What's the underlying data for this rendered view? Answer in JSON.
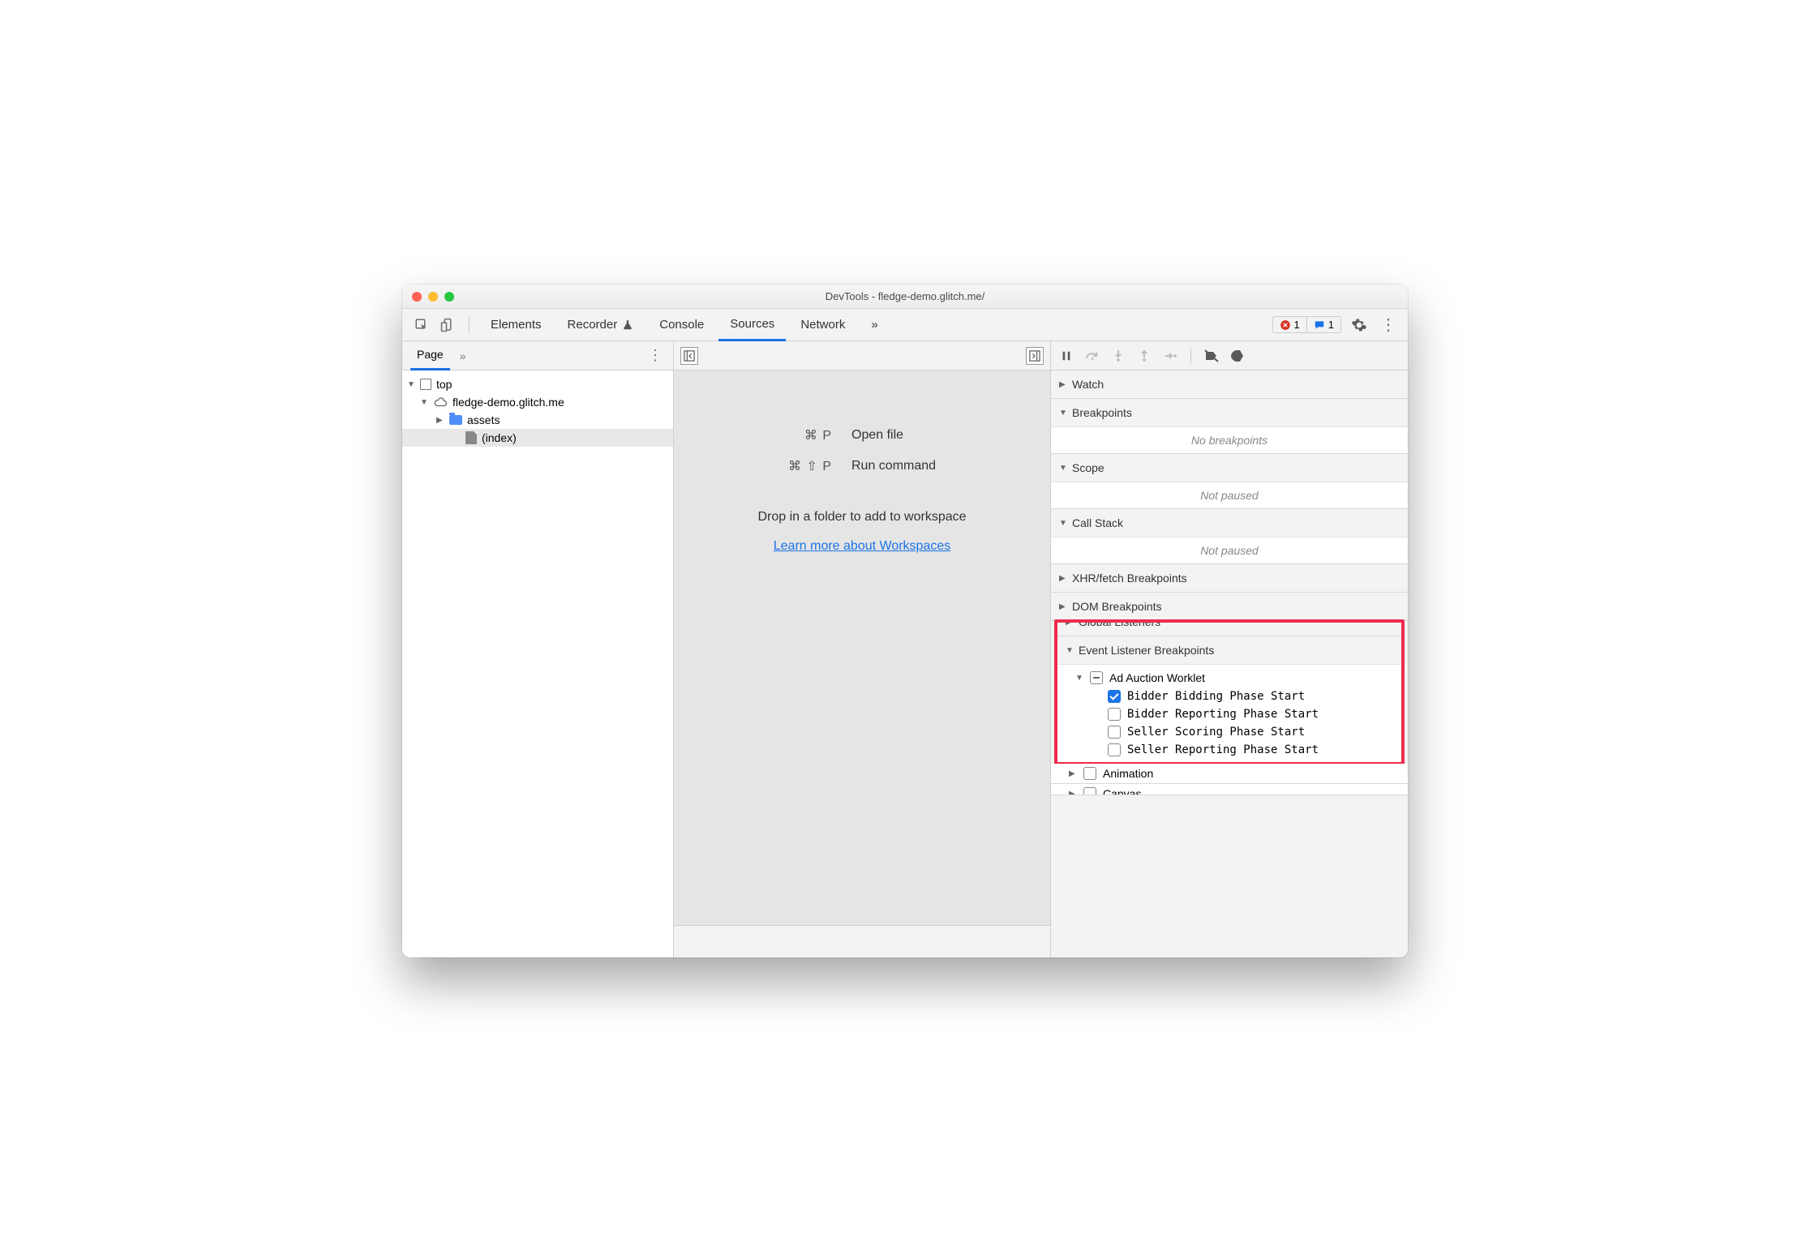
{
  "window": {
    "title": "DevTools - fledge-demo.glitch.me/"
  },
  "toolbar": {
    "tabs": {
      "elements": "Elements",
      "recorder": "Recorder",
      "console": "Console",
      "sources": "Sources",
      "network": "Network"
    },
    "more_glyph": "»",
    "errors_count": "1",
    "messages_count": "1"
  },
  "left": {
    "page_tab": "Page",
    "more_glyph": "»",
    "tree": {
      "top": "top",
      "domain": "fledge-demo.glitch.me",
      "assets": "assets",
      "index": "(index)"
    }
  },
  "mid": {
    "open_file_keys": "⌘ P",
    "open_file_label": "Open file",
    "run_cmd_keys": "⌘ ⇧ P",
    "run_cmd_label": "Run command",
    "drop_hint": "Drop in a folder to add to workspace",
    "learn_more": "Learn more about Workspaces"
  },
  "right": {
    "sections": {
      "watch": "Watch",
      "breakpoints": "Breakpoints",
      "breakpoints_body": "No breakpoints",
      "scope": "Scope",
      "scope_body": "Not paused",
      "callstack": "Call Stack",
      "callstack_body": "Not paused",
      "xhr": "XHR/fetch Breakpoints",
      "dom": "DOM Breakpoints",
      "global": "Global Listeners",
      "elb": "Event Listener Breakpoints",
      "animation": "Animation",
      "canvas": "Canvas"
    },
    "elb_category": "Ad Auction Worklet",
    "elb_items": {
      "bidder_bid": "Bidder Bidding Phase Start",
      "bidder_rep": "Bidder Reporting Phase Start",
      "seller_score": "Seller Scoring Phase Start",
      "seller_rep": "Seller Reporting Phase Start"
    }
  }
}
